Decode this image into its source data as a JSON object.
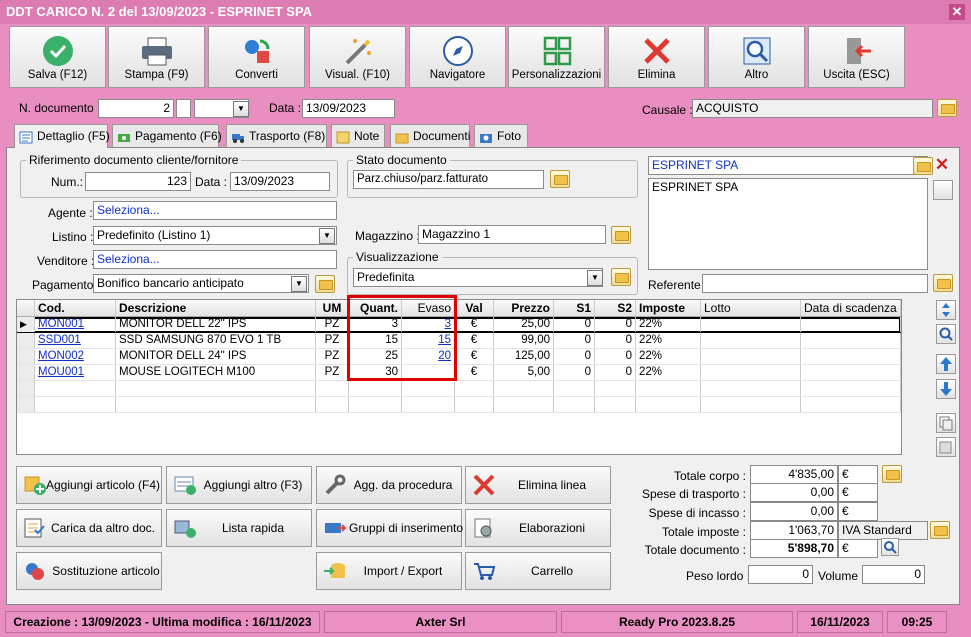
{
  "window": {
    "title": "DDT CARICO N. 2 del 13/09/2023 - ESPRINET SPA"
  },
  "toolbar": [
    {
      "label": "Salva (F12)",
      "icon": "check-icon"
    },
    {
      "label": "Stampa (F9)",
      "icon": "printer-icon"
    },
    {
      "label": "Converti",
      "icon": "convert-icon"
    },
    {
      "label": "Visual. (F10)",
      "icon": "magic-wand-icon"
    },
    {
      "label": "Navigatore",
      "icon": "compass-icon"
    },
    {
      "label": "Personalizzazioni",
      "icon": "layout-icon"
    },
    {
      "label": "Elimina",
      "icon": "delete-x-icon"
    },
    {
      "label": "Altro",
      "icon": "magnifier-icon"
    },
    {
      "label": "Uscita (ESC)",
      "icon": "exit-icon"
    }
  ],
  "header": {
    "ndoc_label": "N. documento :",
    "ndoc_value": "2",
    "data_label": "Data :",
    "data_value": "13/09/2023",
    "causale_label": "Causale :",
    "causale_value": "ACQUISTO"
  },
  "tabs": [
    "Dettaglio (F5)",
    "Pagamento (F6)",
    "Trasporto (F8)",
    "Note",
    "Documenti",
    "Foto"
  ],
  "riferimento": {
    "title": "Riferimento documento cliente/fornitore",
    "num_label": "Num.:",
    "num_value": "123",
    "data_label": "Data :",
    "data_value": "13/09/2023"
  },
  "stato": {
    "title": "Stato documento",
    "value": "Parz.chiuso/parz.fatturato"
  },
  "cliente": {
    "name": "ESPRINET SPA",
    "address": "ESPRINET SPA",
    "referente_label": "Referente",
    "referente_value": ""
  },
  "form": {
    "agente_label": "Agente :",
    "agente_value": "Seleziona...",
    "listino_label": "Listino :",
    "listino_value": "Predefinito (Listino 1)",
    "venditore_label": "Venditore :",
    "venditore_value": "Seleziona...",
    "pagamento_label": "Pagamento :",
    "pagamento_value": "Bonifico bancario anticipato",
    "magazzino_label": "Magazzino :",
    "magazzino_value": "Magazzino 1",
    "visual_title": "Visualizzazione",
    "visual_value": "Predefinita"
  },
  "grid": {
    "columns": [
      "Cod.",
      "Descrizione",
      "UM",
      "Quant.",
      "Evaso",
      "Val",
      "Prezzo",
      "S1",
      "S2",
      "Imposte",
      "Lotto",
      "Data di scadenza"
    ],
    "rows": [
      {
        "cod": "MON001",
        "desc": "MONITOR DELL 22\" IPS",
        "um": "PZ",
        "quant": "3",
        "evaso": "3",
        "val": "€",
        "prezzo": "25,00",
        "s1": "0",
        "s2": "0",
        "imposte": "22%"
      },
      {
        "cod": "SSD001",
        "desc": "SSD SAMSUNG 870 EVO 1 TB",
        "um": "PZ",
        "quant": "15",
        "evaso": "15",
        "val": "€",
        "prezzo": "99,00",
        "s1": "0",
        "s2": "0",
        "imposte": "22%"
      },
      {
        "cod": "MON002",
        "desc": "MONITOR DELL 24\" IPS",
        "um": "PZ",
        "quant": "25",
        "evaso": "20",
        "val": "€",
        "prezzo": "125,00",
        "s1": "0",
        "s2": "0",
        "imposte": "22%"
      },
      {
        "cod": "MOU001",
        "desc": "MOUSE LOGITECH M100",
        "um": "PZ",
        "quant": "30",
        "evaso": "",
        "val": "€",
        "prezzo": "5,00",
        "s1": "0",
        "s2": "0",
        "imposte": "22%"
      }
    ]
  },
  "actions": [
    {
      "label": "Aggiungi articolo (F4)",
      "icon": "add-item-icon"
    },
    {
      "label": "Aggiungi altro (F3)",
      "icon": "add-other-icon"
    },
    {
      "label": "Agg. da procedura",
      "icon": "wrench-icon"
    },
    {
      "label": "Elimina linea",
      "icon": "delete-line-icon"
    },
    {
      "label": "Carica da altro doc.",
      "icon": "load-doc-icon"
    },
    {
      "label": "Lista rapida",
      "icon": "quick-list-icon"
    },
    {
      "label": "Gruppi di inserimento",
      "icon": "groups-icon"
    },
    {
      "label": "Elaborazioni",
      "icon": "process-icon"
    },
    {
      "label": "Sostituzione articolo",
      "icon": "replace-icon"
    },
    {
      "label": "Import / Export",
      "icon": "import-export-icon"
    },
    {
      "label": "Carrello",
      "icon": "cart-icon"
    }
  ],
  "totals": {
    "totale_corpo_label": "Totale corpo :",
    "totale_corpo": "4'835,00",
    "spese_trasporto_label": "Spese di trasporto :",
    "spese_trasporto": "0,00",
    "spese_incasso_label": "Spese di incasso :",
    "spese_incasso": "0,00",
    "totale_imposte_label": "Totale imposte :",
    "totale_imposte": "1'063,70",
    "iva": "IVA Standard",
    "totale_documento_label": "Totale documento :",
    "totale_documento": "5'898,70",
    "currency": "€",
    "peso_lordo_label": "Peso lordo :",
    "peso_lordo": "0",
    "volume_label": "Volume :",
    "volume": "0"
  },
  "status": {
    "creazione": "Creazione : 13/09/2023 - Ultima modifica : 16/11/2023",
    "company": "Axter Srl",
    "version": "Ready Pro 2023.8.25",
    "date": "16/11/2023",
    "time": "09:25"
  },
  "colors": {
    "accent": "#e98ec0",
    "titlebar": "#dc7cb2",
    "highlight": "#e00000"
  }
}
